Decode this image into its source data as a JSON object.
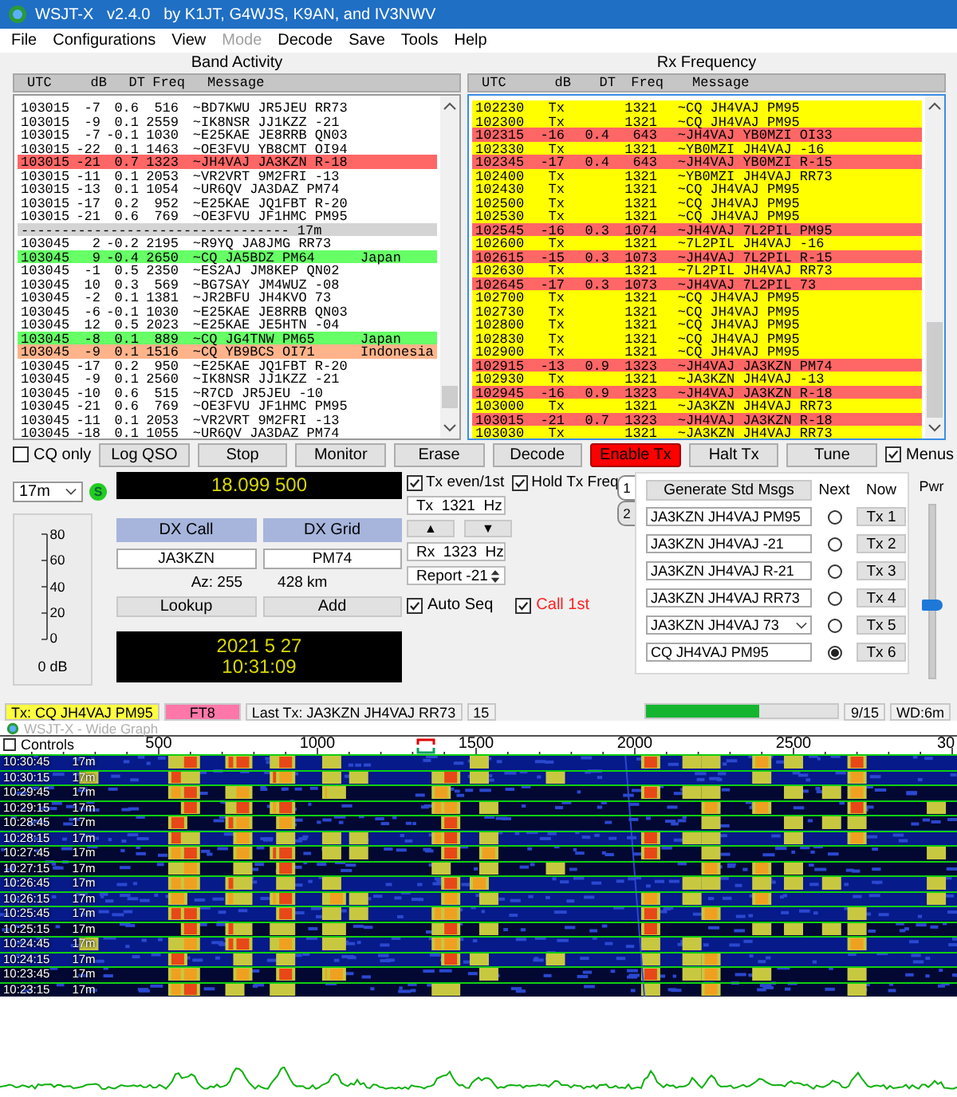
{
  "window": {
    "title": "WSJT-X   v2.4.0   by K1JT, G4WJS, K9AN, and IV3NWV"
  },
  "menu": [
    {
      "label": "File",
      "disabled": false
    },
    {
      "label": "Configurations",
      "disabled": false
    },
    {
      "label": "View",
      "disabled": false
    },
    {
      "label": "Mode",
      "disabled": true
    },
    {
      "label": "Decode",
      "disabled": false
    },
    {
      "label": "Save",
      "disabled": false
    },
    {
      "label": "Tools",
      "disabled": false
    },
    {
      "label": "Help",
      "disabled": false
    }
  ],
  "band_activity": {
    "title": "Band Activity",
    "columns": [
      "UTC",
      "dB",
      "DT",
      "Freq",
      "Message"
    ],
    "rows": [
      {
        "kind": "decode",
        "utc": "103015",
        "db": "-7",
        "dt": "0.6",
        "freq": "516",
        "mode": "~",
        "message": "BD7KWU JR5JEU RR73"
      },
      {
        "kind": "decode",
        "utc": "103015",
        "db": "-9",
        "dt": "0.1",
        "freq": "2559",
        "mode": "~",
        "message": "IK8NSR JJ1KZZ -21"
      },
      {
        "kind": "decode",
        "utc": "103015",
        "db": "-7",
        "dt": "-0.1",
        "freq": "1030",
        "mode": "~",
        "message": "E25KAE JE8RRB QN03"
      },
      {
        "kind": "decode",
        "utc": "103015",
        "db": "-22",
        "dt": "0.1",
        "freq": "1463",
        "mode": "~",
        "message": "OE3FVU YB8CMT OI94"
      },
      {
        "kind": "decode",
        "utc": "103015",
        "db": "-21",
        "dt": "0.7",
        "freq": "1323",
        "mode": "~",
        "message": "JH4VAJ JA3KZN R-18",
        "color": "#ff6666"
      },
      {
        "kind": "decode",
        "utc": "103015",
        "db": "-11",
        "dt": "0.1",
        "freq": "2053",
        "mode": "~",
        "message": "VR2VRT 9M2FRI -13"
      },
      {
        "kind": "decode",
        "utc": "103015",
        "db": "-13",
        "dt": "0.1",
        "freq": "1054",
        "mode": "~",
        "message": "UR6QV JA3DAZ PM74"
      },
      {
        "kind": "decode",
        "utc": "103015",
        "db": "-17",
        "dt": "0.2",
        "freq": "952",
        "mode": "~",
        "message": "E25KAE JQ1FBT R-20"
      },
      {
        "kind": "decode",
        "utc": "103015",
        "db": "-21",
        "dt": "0.6",
        "freq": "769",
        "mode": "~",
        "message": "OE3FVU JF1HMC PM95"
      },
      {
        "kind": "separator",
        "text": "--------------------------------- 17m"
      },
      {
        "kind": "decode",
        "utc": "103045",
        "db": "2",
        "dt": "-0.2",
        "freq": "2195",
        "mode": "~",
        "message": "R9YQ JA8JMG RR73"
      },
      {
        "kind": "decode",
        "utc": "103045",
        "db": "9",
        "dt": "-0.4",
        "freq": "2650",
        "mode": "~",
        "message": "CQ JA5BDZ PM64",
        "country": "Japan",
        "color": "#66ff66"
      },
      {
        "kind": "decode",
        "utc": "103045",
        "db": "-1",
        "dt": "0.5",
        "freq": "2350",
        "mode": "~",
        "message": "ES2AJ JM8KEP QN02"
      },
      {
        "kind": "decode",
        "utc": "103045",
        "db": "10",
        "dt": "0.3",
        "freq": "569",
        "mode": "~",
        "message": "BG7SAY JM4WUZ -08"
      },
      {
        "kind": "decode",
        "utc": "103045",
        "db": "-2",
        "dt": "0.1",
        "freq": "1381",
        "mode": "~",
        "message": "JR2BFU JH4KVO 73"
      },
      {
        "kind": "decode",
        "utc": "103045",
        "db": "-6",
        "dt": "-0.1",
        "freq": "1030",
        "mode": "~",
        "message": "E25KAE JE8RRB QN03"
      },
      {
        "kind": "decode",
        "utc": "103045",
        "db": "12",
        "dt": "0.5",
        "freq": "2023",
        "mode": "~",
        "message": "E25KAE JE5HTN -04"
      },
      {
        "kind": "decode",
        "utc": "103045",
        "db": "-8",
        "dt": "0.1",
        "freq": "889",
        "mode": "~",
        "message": "CQ JG4TNW PM65",
        "country": "Japan",
        "color": "#66ff66"
      },
      {
        "kind": "decode",
        "utc": "103045",
        "db": "-9",
        "dt": "0.1",
        "freq": "1516",
        "mode": "~",
        "message": "CQ YB9BCS OI71",
        "country": "Indonesia",
        "color": "#ffb38a"
      },
      {
        "kind": "decode",
        "utc": "103045",
        "db": "-17",
        "dt": "0.2",
        "freq": "950",
        "mode": "~",
        "message": "E25KAE JQ1FBT R-20"
      },
      {
        "kind": "decode",
        "utc": "103045",
        "db": "-9",
        "dt": "0.1",
        "freq": "2560",
        "mode": "~",
        "message": "IK8NSR JJ1KZZ -21"
      },
      {
        "kind": "decode",
        "utc": "103045",
        "db": "-10",
        "dt": "0.6",
        "freq": "515",
        "mode": "~",
        "message": "R7CD JR5JEU -10"
      },
      {
        "kind": "decode",
        "utc": "103045",
        "db": "-21",
        "dt": "0.6",
        "freq": "769",
        "mode": "~",
        "message": "OE3FVU JF1HMC PM95"
      },
      {
        "kind": "decode",
        "utc": "103045",
        "db": "-11",
        "dt": "0.1",
        "freq": "2053",
        "mode": "~",
        "message": "VR2VRT 9M2FRI -13"
      },
      {
        "kind": "decode",
        "utc": "103045",
        "db": "-18",
        "dt": "0.1",
        "freq": "1055",
        "mode": "~",
        "message": "UR6QV JA3DAZ PM74"
      }
    ]
  },
  "rx_frequency": {
    "title": "Rx Frequency",
    "columns": [
      "UTC",
      "dB",
      "DT",
      "Freq",
      "Message"
    ],
    "rows": [
      {
        "kind": "decode",
        "utc": "102230",
        "db": "Tx",
        "freq": "1321",
        "mode": "~",
        "message": "CQ JH4VAJ PM95",
        "color": "#ffff00"
      },
      {
        "kind": "decode",
        "utc": "102300",
        "db": "Tx",
        "freq": "1321",
        "mode": "~",
        "message": "CQ JH4VAJ PM95",
        "color": "#ffff00"
      },
      {
        "kind": "decode",
        "utc": "102315",
        "db": "-16",
        "dt": "0.4",
        "freq": "643",
        "mode": "~",
        "message": "JH4VAJ YB0MZI OI33",
        "color": "#ff6666"
      },
      {
        "kind": "decode",
        "utc": "102330",
        "db": "Tx",
        "freq": "1321",
        "mode": "~",
        "message": "YB0MZI JH4VAJ -16",
        "color": "#ffff00"
      },
      {
        "kind": "decode",
        "utc": "102345",
        "db": "-17",
        "dt": "0.4",
        "freq": "643",
        "mode": "~",
        "message": "JH4VAJ YB0MZI R-15",
        "color": "#ff6666"
      },
      {
        "kind": "decode",
        "utc": "102400",
        "db": "Tx",
        "freq": "1321",
        "mode": "~",
        "message": "YB0MZI JH4VAJ RR73",
        "color": "#ffff00"
      },
      {
        "kind": "decode",
        "utc": "102430",
        "db": "Tx",
        "freq": "1321",
        "mode": "~",
        "message": "CQ JH4VAJ PM95",
        "color": "#ffff00"
      },
      {
        "kind": "decode",
        "utc": "102500",
        "db": "Tx",
        "freq": "1321",
        "mode": "~",
        "message": "CQ JH4VAJ PM95",
        "color": "#ffff00"
      },
      {
        "kind": "decode",
        "utc": "102530",
        "db": "Tx",
        "freq": "1321",
        "mode": "~",
        "message": "CQ JH4VAJ PM95",
        "color": "#ffff00"
      },
      {
        "kind": "decode",
        "utc": "102545",
        "db": "-16",
        "dt": "0.3",
        "freq": "1074",
        "mode": "~",
        "message": "JH4VAJ 7L2PIL PM95",
        "color": "#ff6666"
      },
      {
        "kind": "decode",
        "utc": "102600",
        "db": "Tx",
        "freq": "1321",
        "mode": "~",
        "message": "7L2PIL JH4VAJ -16",
        "color": "#ffff00"
      },
      {
        "kind": "decode",
        "utc": "102615",
        "db": "-15",
        "dt": "0.3",
        "freq": "1073",
        "mode": "~",
        "message": "JH4VAJ 7L2PIL R-15",
        "color": "#ff6666"
      },
      {
        "kind": "decode",
        "utc": "102630",
        "db": "Tx",
        "freq": "1321",
        "mode": "~",
        "message": "7L2PIL JH4VAJ RR73",
        "color": "#ffff00"
      },
      {
        "kind": "decode",
        "utc": "102645",
        "db": "-17",
        "dt": "0.3",
        "freq": "1073",
        "mode": "~",
        "message": "JH4VAJ 7L2PIL 73",
        "color": "#ff6666"
      },
      {
        "kind": "decode",
        "utc": "102700",
        "db": "Tx",
        "freq": "1321",
        "mode": "~",
        "message": "CQ JH4VAJ PM95",
        "color": "#ffff00"
      },
      {
        "kind": "decode",
        "utc": "102730",
        "db": "Tx",
        "freq": "1321",
        "mode": "~",
        "message": "CQ JH4VAJ PM95",
        "color": "#ffff00"
      },
      {
        "kind": "decode",
        "utc": "102800",
        "db": "Tx",
        "freq": "1321",
        "mode": "~",
        "message": "CQ JH4VAJ PM95",
        "color": "#ffff00"
      },
      {
        "kind": "decode",
        "utc": "102830",
        "db": "Tx",
        "freq": "1321",
        "mode": "~",
        "message": "CQ JH4VAJ PM95",
        "color": "#ffff00"
      },
      {
        "kind": "decode",
        "utc": "102900",
        "db": "Tx",
        "freq": "1321",
        "mode": "~",
        "message": "CQ JH4VAJ PM95",
        "color": "#ffff00"
      },
      {
        "kind": "decode",
        "utc": "102915",
        "db": "-13",
        "dt": "0.9",
        "freq": "1323",
        "mode": "~",
        "message": "JH4VAJ JA3KZN PM74",
        "color": "#ff6666"
      },
      {
        "kind": "decode",
        "utc": "102930",
        "db": "Tx",
        "freq": "1321",
        "mode": "~",
        "message": "JA3KZN JH4VAJ -13",
        "color": "#ffff00"
      },
      {
        "kind": "decode",
        "utc": "102945",
        "db": "-16",
        "dt": "0.9",
        "freq": "1323",
        "mode": "~",
        "message": "JH4VAJ JA3KZN R-18",
        "color": "#ff6666"
      },
      {
        "kind": "decode",
        "utc": "103000",
        "db": "Tx",
        "freq": "1321",
        "mode": "~",
        "message": "JA3KZN JH4VAJ RR73",
        "color": "#ffff00"
      },
      {
        "kind": "decode",
        "utc": "103015",
        "db": "-21",
        "dt": "0.7",
        "freq": "1323",
        "mode": "~",
        "message": "JH4VAJ JA3KZN R-18",
        "color": "#ff6666"
      },
      {
        "kind": "decode",
        "utc": "103030",
        "db": "Tx",
        "freq": "1321",
        "mode": "~",
        "message": "JA3KZN JH4VAJ RR73",
        "color": "#ffff00"
      }
    ]
  },
  "cq_only": {
    "label": "CQ only",
    "checked": false
  },
  "buttons": [
    {
      "label": "Log QSO",
      "on": false
    },
    {
      "label": "Stop",
      "on": false
    },
    {
      "label": "Monitor",
      "on": false
    },
    {
      "label": "Erase",
      "on": false
    },
    {
      "label": "Decode",
      "on": false
    },
    {
      "label": "Enable Tx",
      "on": true
    },
    {
      "label": "Halt Tx",
      "on": false
    },
    {
      "label": "Tune",
      "on": false
    }
  ],
  "menus": {
    "label": "Menus",
    "checked": true
  },
  "controls": {
    "band": "17m",
    "s_indicator": "S",
    "meter_ticks": [
      "80",
      "60",
      "40",
      "20",
      "0"
    ],
    "meter_reading": "0 dB",
    "frequency": "18.099 500",
    "dx_call": {
      "label": "DX Call",
      "value": "JA3KZN"
    },
    "dx_grid": {
      "label": "DX Grid",
      "value": "PM74"
    },
    "azimuth": "Az: 255",
    "distance": "428 km",
    "lookup": "Lookup",
    "add": "Add",
    "date": "2021 5 27",
    "time": "10:31:09",
    "tx_even": {
      "label": "Tx even/1st",
      "checked": true
    },
    "hold_tx_freq": {
      "label": "Hold Tx Freq",
      "checked": true
    },
    "tx_freq": "Tx  1321  Hz",
    "up": "▲",
    "down": "▼",
    "rx_freq": "Rx  1323  Hz",
    "report": "Report -21",
    "auto_seq": {
      "label": "Auto Seq",
      "checked": true
    },
    "call_1st": {
      "label": "Call 1st",
      "checked": true
    }
  },
  "message_tabs": [
    {
      "label": "1",
      "selected": true
    },
    {
      "label": "2",
      "selected": false
    }
  ],
  "messages_panel": {
    "generate": "Generate Std Msgs",
    "next_header": "Next",
    "now_header": "Now",
    "messages": [
      {
        "kind": "field",
        "text": "JA3KZN JH4VAJ PM95",
        "selected": false,
        "button": "Tx 1"
      },
      {
        "kind": "field",
        "text": "JA3KZN JH4VAJ -21",
        "selected": false,
        "button": "Tx 2"
      },
      {
        "kind": "field",
        "text": "JA3KZN JH4VAJ R-21",
        "selected": false,
        "button": "Tx 3"
      },
      {
        "kind": "field",
        "text": "JA3KZN JH4VAJ RR73",
        "selected": false,
        "button": "Tx 4"
      },
      {
        "kind": "combo",
        "text": "JA3KZN JH4VAJ 73",
        "selected": false,
        "button": "Tx 5"
      },
      {
        "kind": "field",
        "text": "CQ JH4VAJ PM95",
        "selected": true,
        "button": "Tx 6"
      }
    ]
  },
  "power": {
    "label": "Pwr",
    "level": 0.42
  },
  "status_bar": {
    "tx_message": "Tx: CQ JH4VAJ PM95",
    "mode": "FT8",
    "last_tx": "Last Tx: JA3KZN JH4VAJ RR73",
    "period": "15",
    "progress": {
      "level": 0.59
    },
    "progress_text": "9/15",
    "watchdog": "WD:6m"
  },
  "wide_graph": {
    "title": "WSJT-X - Wide Graph",
    "controls": {
      "label": "Controls",
      "checked": false
    },
    "scale": [
      "500",
      "1000",
      "1500",
      "2000",
      "2500",
      "30"
    ],
    "rows": [
      {
        "time": "10:30:45",
        "band": "17m"
      },
      {
        "time": "10:30:15",
        "band": "17m"
      },
      {
        "time": "10:29:45",
        "band": "17m"
      },
      {
        "time": "10:29:15",
        "band": "17m"
      },
      {
        "time": "10:28:45",
        "band": "17m"
      },
      {
        "time": "10:28:15",
        "band": "17m"
      },
      {
        "time": "10:27:45",
        "band": "17m"
      },
      {
        "time": "10:27:15",
        "band": "17m"
      },
      {
        "time": "10:26:45",
        "band": "17m"
      },
      {
        "time": "10:26:15",
        "band": "17m"
      },
      {
        "time": "10:25:45",
        "band": "17m"
      },
      {
        "time": "10:25:15",
        "band": "17m"
      },
      {
        "time": "10:24:45",
        "band": "17m"
      },
      {
        "time": "10:24:15",
        "band": "17m"
      },
      {
        "time": "10:23:45",
        "band": "17m"
      },
      {
        "time": "10:23:15",
        "band": "17m"
      }
    ]
  }
}
